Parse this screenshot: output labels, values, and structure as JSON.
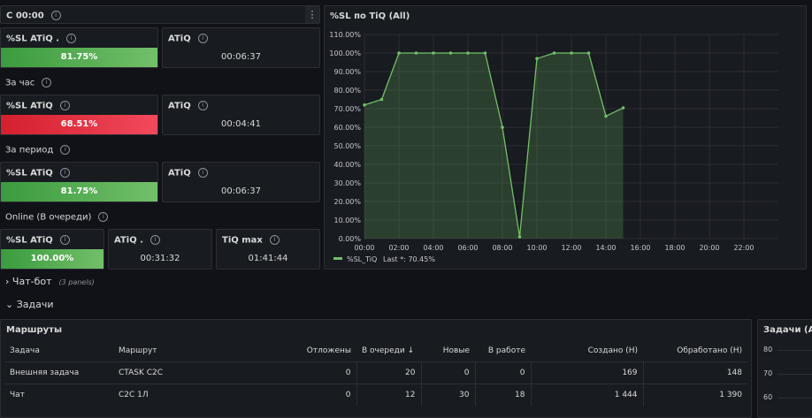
{
  "top_bar": {
    "title": "С 00:00",
    "menu_icon": "vertical-dots-icon"
  },
  "since_start": {
    "sl_title": "%SL ATiQ .",
    "sl_value": "81.75%",
    "atiq_title": "ATiQ",
    "atiq_value": "00:06:37"
  },
  "hour": {
    "label": "За час",
    "sl_title": "%SL ATiQ",
    "sl_value": "68.51%",
    "atiq_title": "ATiQ",
    "atiq_value": "00:04:41"
  },
  "period": {
    "label": "За период",
    "sl_title": "%SL ATiQ",
    "sl_value": "81.75%",
    "atiq_title": "ATiQ",
    "atiq_value": "00:06:37"
  },
  "online": {
    "label": "Online (В очереди)",
    "sl_title": "%SL ATiQ",
    "sl_value": "100.00%",
    "atiq_title": "ATiQ .",
    "atiq_value": "00:31:32",
    "tiq_title": "TiQ max",
    "tiq_value": "01:41:44"
  },
  "chart_panel": {
    "title": "%SL по TiQ (All)"
  },
  "chart_data": {
    "type": "area",
    "ylim": [
      0,
      110
    ],
    "y_ticks": [
      "0.00%",
      "10.00%",
      "20.00%",
      "30.00%",
      "40.00%",
      "50.00%",
      "60.00%",
      "70.00%",
      "80.00%",
      "90.00%",
      "100.00%",
      "110.00%"
    ],
    "x_ticks": [
      "00:00",
      "02:00",
      "04:00",
      "06:00",
      "08:00",
      "10:00",
      "12:00",
      "14:00",
      "16:00",
      "18:00",
      "20:00",
      "22:00"
    ],
    "xlim": [
      0,
      24
    ],
    "series": [
      {
        "name": "%SL_TiQ",
        "color": "#73bf69",
        "x": [
          0,
          1,
          2,
          3,
          4,
          5,
          6,
          7,
          8,
          9,
          10,
          11,
          12,
          13,
          14,
          15
        ],
        "values": [
          72,
          75,
          100,
          100,
          100,
          100,
          100,
          100,
          60,
          1,
          97,
          100,
          100,
          100,
          66,
          70.45
        ]
      }
    ],
    "legend": {
      "label": "%SL_TiQ",
      "last_text": "Last *: 70.45%"
    }
  },
  "rows": {
    "chatbot": {
      "label": "Чат-бот",
      "sub": "(3 panels)"
    },
    "tasks": {
      "label": "Задачи"
    }
  },
  "routes_table": {
    "title": "Маршруты",
    "headers": [
      "Задача",
      "Маршрут",
      "Отложены",
      "В очереди",
      "Новые",
      "В работе",
      "Создано (Н)",
      "Обработано (Н)"
    ],
    "sort_icon": "↓",
    "rows": [
      [
        "Внешняя задача",
        "CTASK C2C",
        "0",
        "20",
        "0",
        "0",
        "169",
        "148"
      ],
      [
        "Чат",
        "C2C 1Л",
        "0",
        "12",
        "30",
        "18",
        "1 444",
        "1 390"
      ]
    ]
  },
  "tasks_panel": {
    "title": "Задачи (All)",
    "y_ticks": [
      "80",
      "70",
      "60"
    ]
  }
}
